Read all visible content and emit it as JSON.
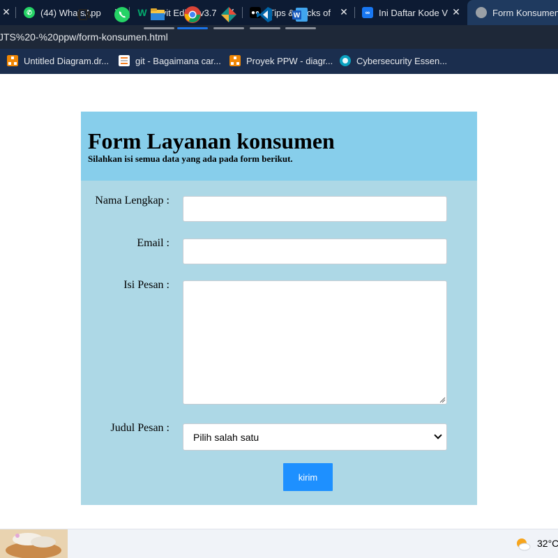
{
  "browser": {
    "tabs": [
      {
        "label": "",
        "icon": "close-icon",
        "active": false
      },
      {
        "label": "(44) WhatsApp",
        "icon": "whatsapp-icon",
        "active": false
      },
      {
        "label": "Tryit Editor v3.7",
        "icon": "w3schools-icon",
        "active": false
      },
      {
        "label": "[Tips & Tricks of",
        "icon": "medium-icon",
        "active": false
      },
      {
        "label": "Ini Daftar Kode V",
        "icon": "meta-icon",
        "active": false
      },
      {
        "label": "Form Konsumen",
        "icon": "globe-icon",
        "active": true
      }
    ],
    "address": "JTS%20-%20ppw/form-konsumen.html",
    "bookmarks": [
      {
        "label": "Untitled Diagram.dr...",
        "icon": "drawio-icon"
      },
      {
        "label": "git - Bagaimana car...",
        "icon": "stackoverflow-icon"
      },
      {
        "label": "Proyek PPW - diagr...",
        "icon": "drawio-icon"
      },
      {
        "label": "Cybersecurity Essen...",
        "icon": "cisco-icon"
      }
    ]
  },
  "form": {
    "title": "Form Layanan konsumen",
    "subtitle": "Silahkan isi semua data yang ada pada form berikut.",
    "fields": {
      "nama_label": "Nama Lengkap :",
      "nama_value": "",
      "email_label": "Email :",
      "email_value": "",
      "pesan_label": "Isi Pesan :",
      "pesan_value": "",
      "judul_label": "Judul Pesan :",
      "judul_selected": "Pilih salah satu"
    },
    "submit_label": "kirim"
  },
  "taskbar": {
    "apps": [
      "weather-widget-icon",
      "task-view-icon",
      "whatsapp-icon",
      "file-explorer-icon",
      "chrome-icon",
      "gitkraken-icon",
      "vscode-icon",
      "word-icon"
    ],
    "temperature": "32°C"
  },
  "colors": {
    "form_body": "#add8e6",
    "form_header": "#87ceeb",
    "submit_button": "#1e90ff",
    "tab_strip": "#0d1b33",
    "bookmarks_bar": "#1b2e4e"
  }
}
